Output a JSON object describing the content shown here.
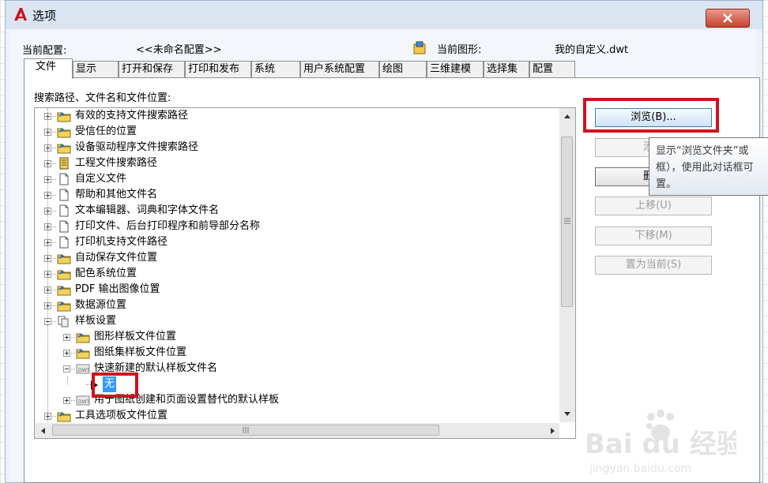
{
  "window": {
    "title": "选项",
    "current_profile_label": "当前配置:",
    "current_profile_value": "<<未命名配置>>",
    "current_drawing_label": "当前图形:",
    "current_drawing_value": "我的自定义.dwt"
  },
  "tabs": [
    "文件",
    "显示",
    "打开和保存",
    "打印和发布",
    "系统",
    "用户系统配置",
    "绘图",
    "三维建模",
    "选择集",
    "配置"
  ],
  "active_tab": "文件",
  "tree_heading": "搜索路径、文件名和文件位置:",
  "tree_items": [
    {
      "label": "有效的支持文件搜索路径",
      "icon": "folder-icon",
      "level": 0,
      "expanded": false
    },
    {
      "label": "受信任的位置",
      "icon": "folder-icon",
      "level": 0,
      "expanded": false
    },
    {
      "label": "设备驱动程序文件搜索路径",
      "icon": "folder-icon",
      "level": 0,
      "expanded": false
    },
    {
      "label": "工程文件搜索路径",
      "icon": "document-icon",
      "level": 0,
      "expanded": false
    },
    {
      "label": "自定义文件",
      "icon": "file-icon",
      "level": 0,
      "expanded": false
    },
    {
      "label": "帮助和其他文件名",
      "icon": "file-icon",
      "level": 0,
      "expanded": false
    },
    {
      "label": "文本编辑器、词典和字体文件名",
      "icon": "file-icon",
      "level": 0,
      "expanded": false
    },
    {
      "label": "打印文件、后台打印程序和前导部分名称",
      "icon": "file-icon",
      "level": 0,
      "expanded": false
    },
    {
      "label": "打印机支持文件路径",
      "icon": "file-icon",
      "level": 0,
      "expanded": false
    },
    {
      "label": "自动保存文件位置",
      "icon": "folder-icon",
      "level": 0,
      "expanded": false
    },
    {
      "label": "配色系统位置",
      "icon": "folder-icon",
      "level": 0,
      "expanded": false
    },
    {
      "label": "PDF 输出图像位置",
      "icon": "folder-icon",
      "level": 0,
      "expanded": false
    },
    {
      "label": "数据源位置",
      "icon": "folder-icon",
      "level": 0,
      "expanded": false
    },
    {
      "label": "样板设置",
      "icon": "template-icon",
      "level": 0,
      "expanded": true
    },
    {
      "label": "图形样板文件位置",
      "icon": "folder-icon",
      "level": 1,
      "expanded": false
    },
    {
      "label": "图纸集样板文件位置",
      "icon": "folder-icon",
      "level": 1,
      "expanded": false
    },
    {
      "label": "快速新建的默认样板文件名",
      "icon": "dwt-icon",
      "level": 1,
      "expanded": true
    },
    {
      "label": "无",
      "icon": "arrow-icon",
      "level": 2,
      "selected": true
    },
    {
      "label": "用于图纸创建和页面设置替代的默认样板",
      "icon": "dwt-icon",
      "level": 1,
      "expanded": false
    },
    {
      "label": "工具选项板文件位置",
      "icon": "folder-icon",
      "level": 0,
      "expanded": false
    }
  ],
  "buttons": {
    "browse": "浏览(B)...",
    "add": "添加",
    "remove": "删除",
    "move_up": "上移(U)",
    "move_down": "下移(M)",
    "set_current": "置为当前(S)"
  },
  "tooltip": "显示“浏览文件夹”或\n框），使用此对话框可\n置。",
  "watermark": {
    "brand": "Bai du 经验",
    "url": "jingyan.baidu.com"
  },
  "colors": {
    "highlight": "#d0121f",
    "selection": "#3399ff",
    "accent": "#3c7fb1"
  }
}
